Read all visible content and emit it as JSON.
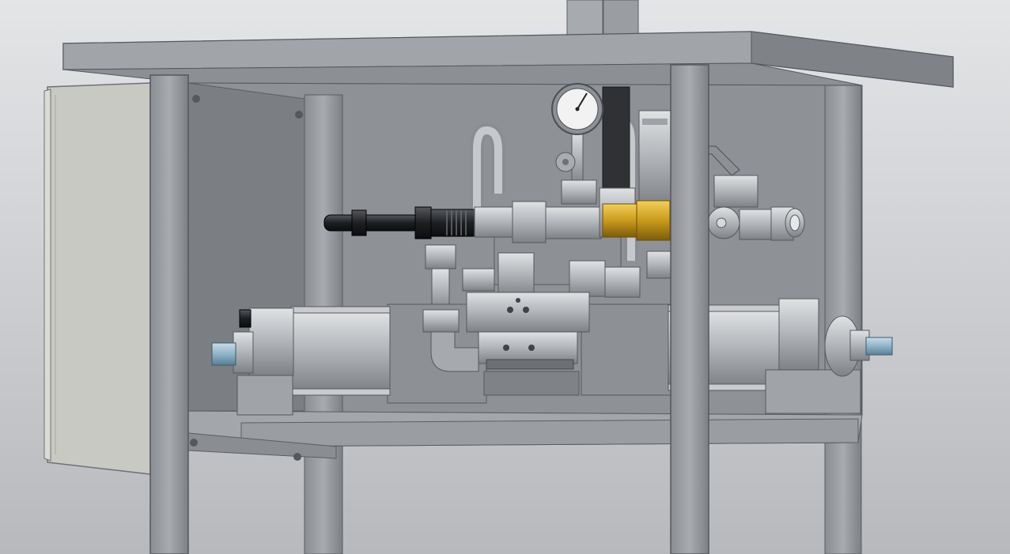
{
  "viewport": {
    "background_top": "#e4e5e7",
    "background_bottom": "#b7b9bd"
  },
  "colors": {
    "frame": "#9b9ea3",
    "frame_dark": "#6f7277",
    "panel": "#8d9095",
    "panel_dark": "#7a7d82",
    "enclosure": "#c7c9c2",
    "steel": "#b5b8bc",
    "steel_light": "#d6d8db",
    "brass": "#c99a1c",
    "black_part": "#1d1f22",
    "blue_fitting": "#8fb3c9",
    "gauge_face": "#f2f2f2"
  },
  "parts": [
    "top-plate",
    "electrical-enclosure",
    "pressure-gauge",
    "needle-valve-handle",
    "black-threaded-rod",
    "brass-fitting",
    "ball-valve",
    "u-bend-pipes",
    "pneumatic-actuator",
    "hydraulic-cylinder-left",
    "hydraulic-cylinder-right",
    "support-legs"
  ]
}
